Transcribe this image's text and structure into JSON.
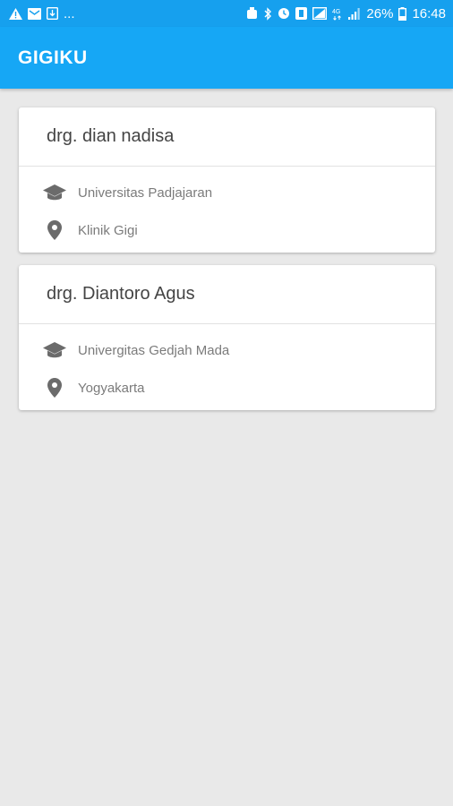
{
  "status_bar": {
    "left_icons": [
      "warning-icon",
      "email-icon",
      "download-icon"
    ],
    "more": "...",
    "right_icons": [
      "alarm-icon",
      "bluetooth-icon",
      "clock-icon",
      "nfc-icon",
      "signal-icon",
      "network-4g-icon",
      "signal-bars-icon"
    ],
    "battery": "26%",
    "time": "16:48"
  },
  "app_bar": {
    "title": "GIGIKU",
    "color": "#16a7f5"
  },
  "doctors": [
    {
      "name": "drg. dian nadisa",
      "education": "Universitas Padjajaran",
      "location": "Klinik Gigi"
    },
    {
      "name": "drg. Diantoro Agus",
      "education": "Univergitas Gedjah Mada",
      "location": "Yogyakarta"
    }
  ],
  "icons": {
    "education": "graduation-cap-icon",
    "location": "map-pin-icon"
  }
}
